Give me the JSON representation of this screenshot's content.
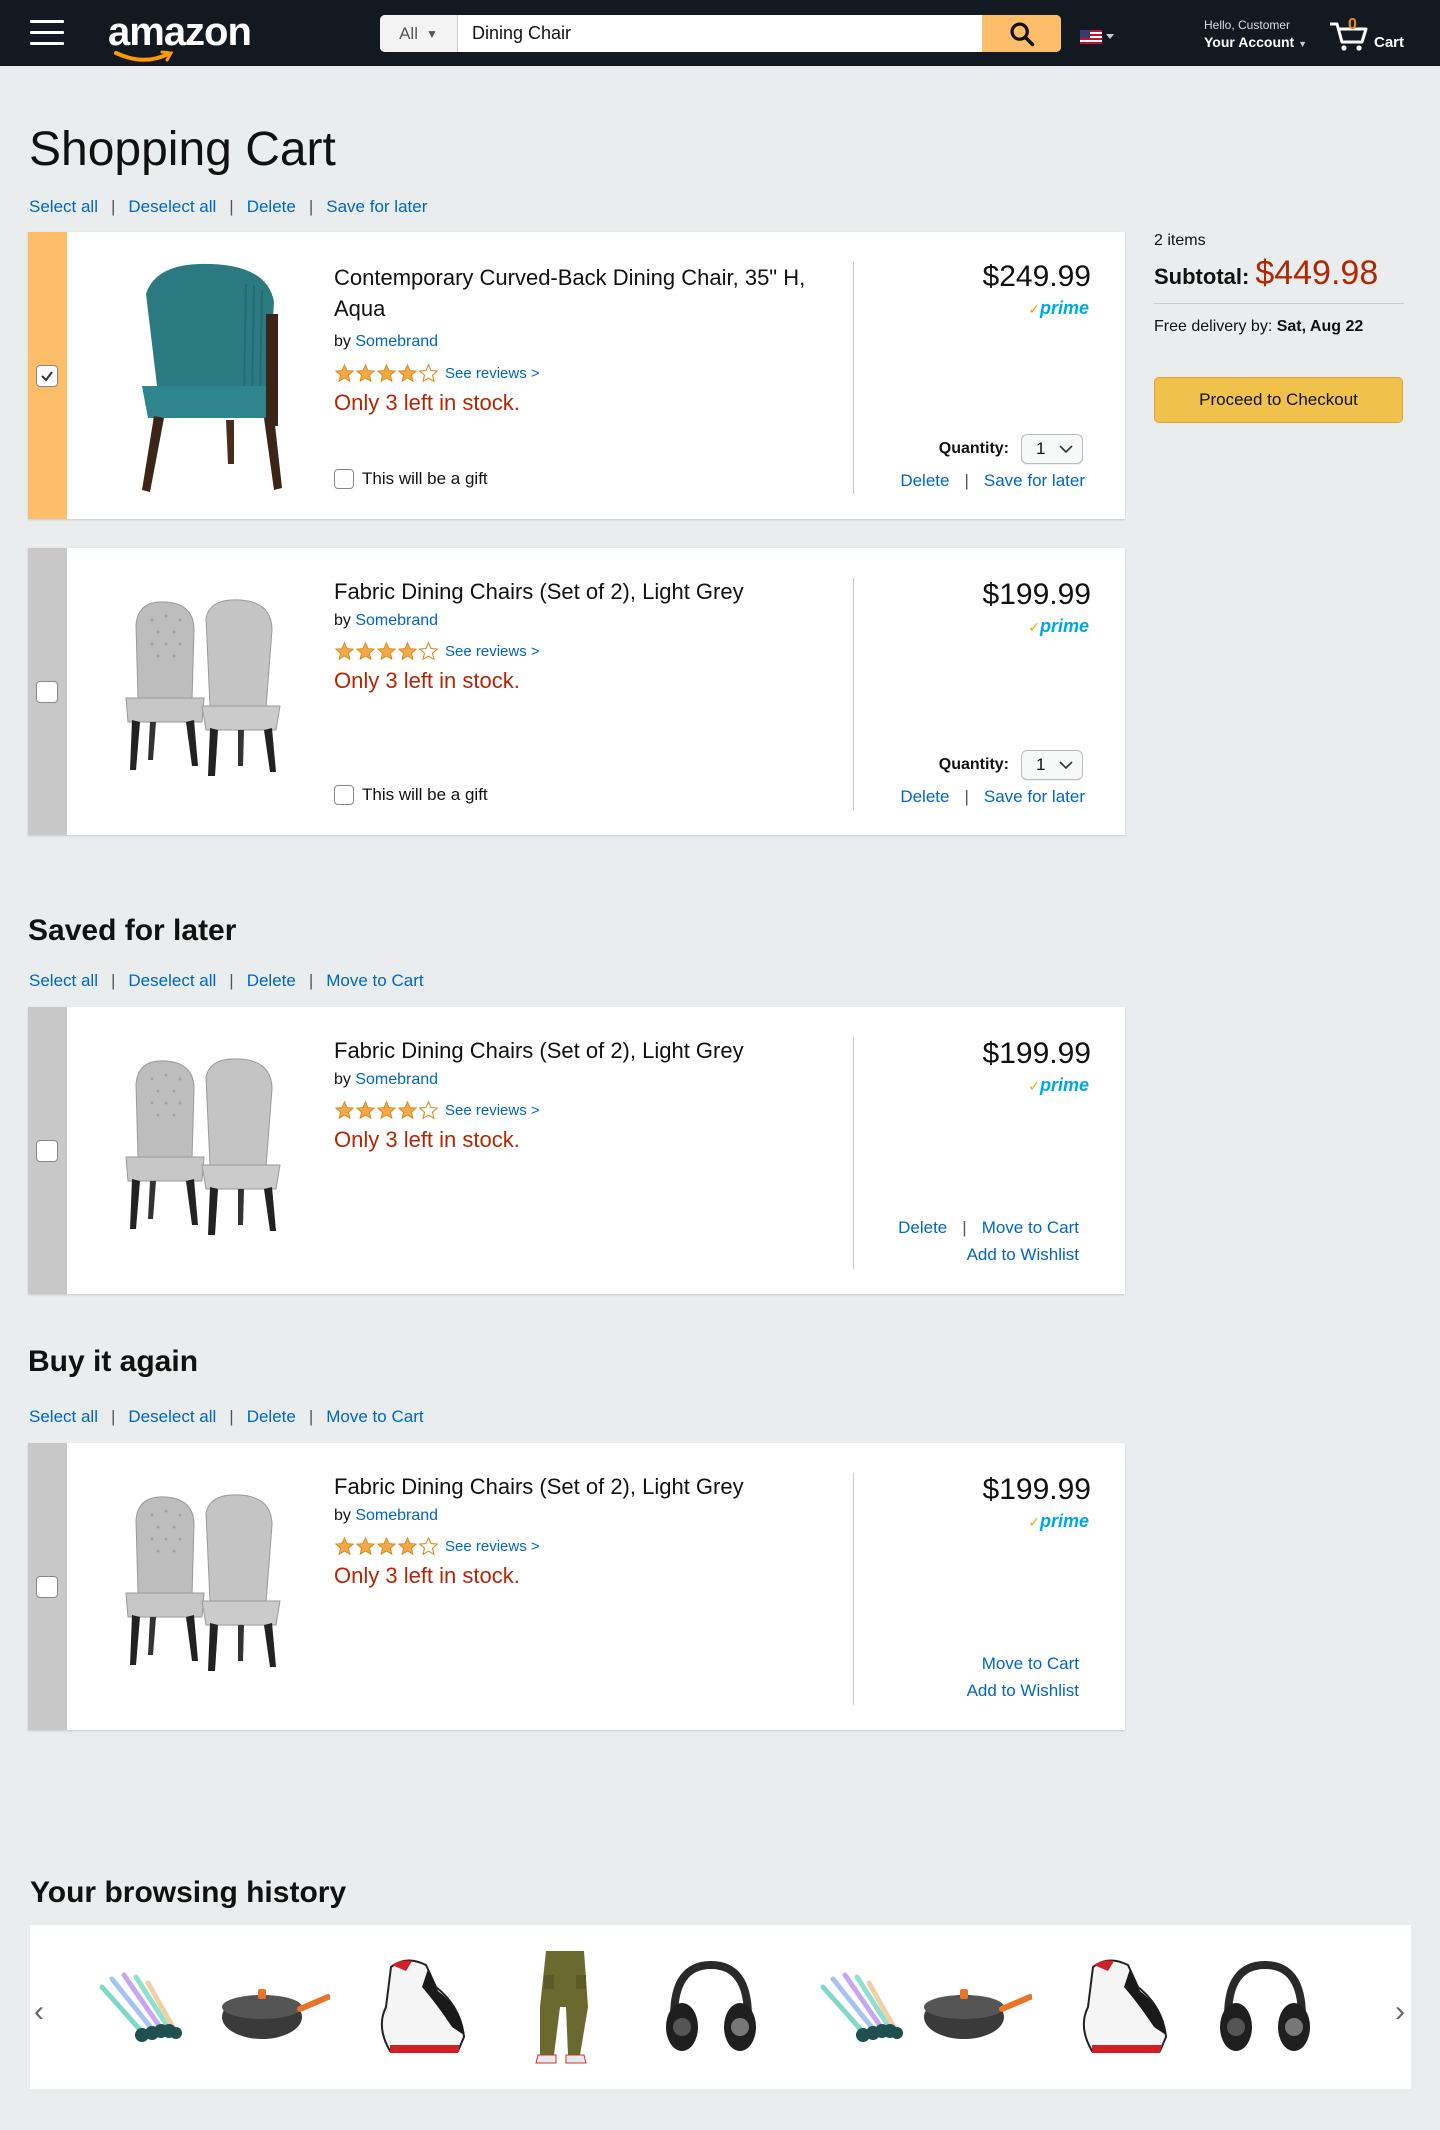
{
  "header": {
    "logo": "amazon",
    "search": {
      "category": "All",
      "value": "Dining Chair"
    },
    "account": {
      "greeting": "Hello, Customer",
      "label": "Your Account"
    },
    "cart": {
      "count": "0",
      "label": "Cart"
    }
  },
  "cart": {
    "title": "Shopping Cart",
    "actions": {
      "select_all": "Select all",
      "deselect_all": "Deselect all",
      "delete": "Delete",
      "save_for_later": "Save for later"
    },
    "items": [
      {
        "title": "Contemporary Curved-Back Dining Chair, 35\" H, Aqua",
        "by": "by ",
        "brand": "Somebrand",
        "reviews": "See reviews >",
        "stock": "Only 3 left in stock.",
        "gift": "This will be a gift",
        "price": "$249.99",
        "prime": "prime",
        "quantity_label": "Quantity:",
        "quantity": "1",
        "delete": "Delete",
        "save_for_later": "Save for later",
        "selected": true,
        "rating": 4
      },
      {
        "title": "Fabric Dining Chairs (Set of 2), Light Grey",
        "by": "by ",
        "brand": "Somebrand",
        "reviews": "See reviews >",
        "stock": "Only 3 left in stock.",
        "gift": "This will be a gift",
        "price": "$199.99",
        "prime": "prime",
        "quantity_label": "Quantity:",
        "quantity": "1",
        "delete": "Delete",
        "save_for_later": "Save for later",
        "selected": false,
        "rating": 4
      }
    ]
  },
  "summary": {
    "count": "2 items",
    "subtotal_label": "Subtotal:",
    "subtotal_value": "$449.98",
    "delivery_label": "Free delivery by: ",
    "delivery_date": "Sat, Aug 22",
    "checkout": "Proceed to Checkout"
  },
  "saved": {
    "title": "Saved for later",
    "actions": {
      "select_all": "Select all",
      "deselect_all": "Deselect all",
      "delete": "Delete",
      "move_to_cart": "Move to Cart"
    },
    "item": {
      "title": "Fabric Dining Chairs (Set of 2), Light Grey",
      "by": "by ",
      "brand": "Somebrand",
      "reviews": "See reviews >",
      "stock": "Only 3 left in stock.",
      "price": "$199.99",
      "prime": "prime",
      "delete": "Delete",
      "move_to_cart": "Move to Cart",
      "add_to_wishlist": "Add to Wishlist",
      "rating": 4
    }
  },
  "buy_again": {
    "title": "Buy it again",
    "actions": {
      "select_all": "Select all",
      "deselect_all": "Deselect all",
      "delete": "Delete",
      "move_to_cart": "Move to Cart"
    },
    "item": {
      "title": "Fabric Dining Chairs (Set of 2), Light Grey",
      "by": "by ",
      "brand": "Somebrand",
      "reviews": "See reviews >",
      "stock": "Only 3 left in stock.",
      "price": "$199.99",
      "prime": "prime",
      "move_to_cart": "Move to Cart",
      "add_to_wishlist": "Add to Wishlist",
      "rating": 4
    }
  },
  "history": {
    "title": "Your browsing history",
    "items": [
      "makeup-brushes",
      "wok-pan",
      "sneaker",
      "cargo-pants",
      "headphones",
      "makeup-brushes",
      "wok-pan",
      "sneaker",
      "headphones"
    ]
  },
  "colors": {
    "nav_bg": "#131921",
    "accent": "#febd69",
    "link": "#0066c0",
    "price_red": "#b12704",
    "prime_blue": "#00a8e1",
    "checkout_btn": "#f0c14b"
  }
}
